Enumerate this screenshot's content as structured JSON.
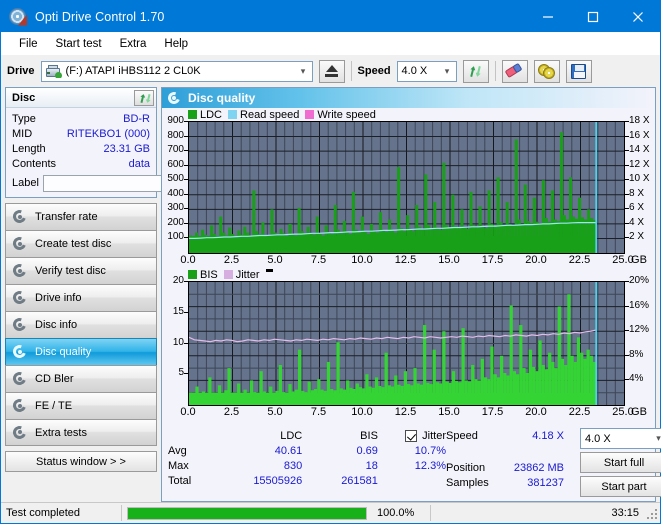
{
  "window": {
    "title": "Opti Drive Control 1.70",
    "app_icon": "disc-icon",
    "minimize": "—",
    "maximize": "□",
    "close": "✕"
  },
  "menu": {
    "items": [
      "File",
      "Start test",
      "Extra",
      "Help"
    ]
  },
  "toolbar": {
    "drive_label": "Drive",
    "drive_value": "(F:)  ATAPI iHBS112  2 CL0K",
    "eject_icon": "eject-icon",
    "speed_label": "Speed",
    "speed_value": "4.0 X",
    "refresh_icon": "refresh-icon",
    "eraser_icon": "eraser-icon",
    "discs_icon": "two-discs-icon",
    "save_icon": "floppy-save-icon"
  },
  "disc_panel": {
    "title": "Disc",
    "refresh_icon": "refresh-icon",
    "rows": [
      {
        "key": "Type",
        "value": "BD-R"
      },
      {
        "key": "MID",
        "value": "RITEKBO1 (000)"
      },
      {
        "key": "Length",
        "value": "23.31 GB"
      },
      {
        "key": "Contents",
        "value": "data"
      }
    ],
    "label_key": "Label",
    "label_value": "",
    "label_placeholder": "",
    "label_button_icon": "disc-icon"
  },
  "sidebar": {
    "items": [
      {
        "label": "Transfer rate",
        "selected": false
      },
      {
        "label": "Create test disc",
        "selected": false
      },
      {
        "label": "Verify test disc",
        "selected": false
      },
      {
        "label": "Drive info",
        "selected": false
      },
      {
        "label": "Disc info",
        "selected": false
      },
      {
        "label": "Disc quality",
        "selected": true
      },
      {
        "label": "CD Bler",
        "selected": false
      },
      {
        "label": "FE / TE",
        "selected": false
      },
      {
        "label": "Extra tests",
        "selected": false
      }
    ],
    "status_window_button": "Status window > >"
  },
  "card": {
    "title": "Disc quality",
    "icon": "disc-quality-icon"
  },
  "chart_data": [
    {
      "type": "bar",
      "title": "Disc quality - LDC",
      "legend": [
        {
          "label": "LDC",
          "color": "#18a018"
        },
        {
          "label": "Read speed",
          "color": "#7fd4f2"
        },
        {
          "label": "Write speed",
          "color": "#f06cd0"
        }
      ],
      "legend_position": "top-left",
      "xlabel": "GB",
      "x": [
        0.0,
        2.5,
        5.0,
        7.5,
        10.0,
        12.5,
        15.0,
        17.5,
        20.0,
        22.5,
        25.0
      ],
      "xlim": [
        0,
        25
      ],
      "ylabel": "LDC",
      "ylim": [
        0,
        900
      ],
      "yticks": [
        100,
        200,
        300,
        400,
        500,
        600,
        700,
        800,
        900
      ],
      "y2label": "Speed",
      "y2lim": [
        0,
        18
      ],
      "y2ticks": [
        "2 X",
        "4 X",
        "6 X",
        "8 X",
        "10 X",
        "12 X",
        "14 X",
        "16 X",
        "18 X"
      ],
      "grid": true,
      "plot_bg": "#66738c",
      "data_end_gb": 23.4,
      "cursor_line_color": "#49d8f4",
      "series": [
        {
          "name": "LDC",
          "color": "#18a018",
          "values": [
            120,
            95,
            140,
            110,
            160,
            125,
            105,
            190,
            130,
            115,
            250,
            140,
            120,
            175,
            130,
            110,
            155,
            125,
            180,
            140,
            120,
            430,
            150,
            130,
            210,
            125,
            115,
            300,
            140,
            125,
            165,
            135,
            115,
            200,
            130,
            120,
            310,
            150,
            130,
            180,
            140,
            125,
            250,
            135,
            120,
            190,
            145,
            130,
            330,
            160,
            135,
            220,
            150,
            130,
            420,
            160,
            140,
            250,
            145,
            130,
            200,
            150,
            140,
            280,
            160,
            145,
            230,
            155,
            140,
            590,
            170,
            150,
            260,
            160,
            150,
            330,
            180,
            160,
            540,
            190,
            165,
            350,
            175,
            160,
            620,
            190,
            170,
            400,
            185,
            170,
            300,
            180,
            165,
            420,
            190,
            175,
            320,
            185,
            170,
            430,
            200,
            180,
            520,
            210,
            190,
            350,
            200,
            190,
            780,
            230,
            200,
            470,
            220,
            205,
            380,
            215,
            200,
            500,
            240,
            215,
            430,
            230,
            220,
            830,
            260,
            230,
            520,
            250,
            235,
            380,
            245,
            230,
            300,
            240,
            225
          ]
        },
        {
          "name": "Read speed",
          "color": "#9fe3f7",
          "values": [
            2.0,
            2.0,
            2.05,
            2.1,
            2.1,
            2.15,
            2.2,
            2.2,
            2.25,
            2.3,
            2.3,
            2.35,
            2.4,
            2.4,
            2.45,
            2.5,
            2.5,
            2.55,
            2.6,
            2.6,
            2.65,
            2.7,
            2.7,
            2.75,
            2.8,
            2.8,
            2.85,
            2.9,
            2.9,
            2.95,
            3.0,
            3.0,
            3.05,
            3.1,
            3.1,
            3.15,
            3.2,
            3.2,
            3.25,
            3.3,
            3.3,
            3.35,
            3.4,
            3.4,
            3.45,
            3.5,
            3.5,
            3.55,
            3.6,
            3.6,
            3.65,
            3.7,
            3.7,
            3.75,
            3.8,
            3.8,
            3.85,
            3.9,
            3.9,
            3.95,
            4.0,
            4.0,
            4.05,
            4.1,
            4.1,
            4.15,
            4.18,
            4.18,
            4.18,
            4.18
          ]
        }
      ]
    },
    {
      "type": "bar",
      "title": "Disc quality - BIS",
      "legend": [
        {
          "label": "BIS",
          "color": "#18a018"
        },
        {
          "label": "Jitter",
          "color": "#d7aee0"
        }
      ],
      "legend_position": "top-left",
      "legend_marker": "black-rect-marker",
      "xlabel": "GB",
      "x": [
        0.0,
        2.5,
        5.0,
        7.5,
        10.0,
        12.5,
        15.0,
        17.5,
        20.0,
        22.5,
        25.0
      ],
      "xlim": [
        0,
        25
      ],
      "ylabel": "BIS",
      "ylim": [
        0,
        20
      ],
      "yticks": [
        5,
        10,
        15,
        20
      ],
      "y2label": "Jitter",
      "y2lim": [
        0,
        20
      ],
      "y2ticks": [
        "4%",
        "8%",
        "12%",
        "16%",
        "20%"
      ],
      "grid": true,
      "plot_bg": "#66738c",
      "data_end_gb": 23.4,
      "cursor_line_color": "#49d8f4",
      "series": [
        {
          "name": "BIS",
          "color": "#35d435",
          "values": [
            2.0,
            1.5,
            3.0,
            1.8,
            2.2,
            1.6,
            4.5,
            2.0,
            1.7,
            3.2,
            1.9,
            2.4,
            6.0,
            1.8,
            2.0,
            3.5,
            1.7,
            2.5,
            1.9,
            4.0,
            2.1,
            1.8,
            5.5,
            2.2,
            1.9,
            3.0,
            2.0,
            2.3,
            6.5,
            2.1,
            2.0,
            3.4,
            2.2,
            2.5,
            9.0,
            2.3,
            2.1,
            3.8,
            2.4,
            2.6,
            4.2,
            2.5,
            2.3,
            7.0,
            2.6,
            2.4,
            10.2,
            2.7,
            2.5,
            4.0,
            2.8,
            2.6,
            3.5,
            2.9,
            2.7,
            5.0,
            3.0,
            2.8,
            4.5,
            3.1,
            2.9,
            8.5,
            3.2,
            3.0,
            4.8,
            3.3,
            3.1,
            5.5,
            3.4,
            3.2,
            6.0,
            3.5,
            3.3,
            13.0,
            3.6,
            3.4,
            9.0,
            3.7,
            3.5,
            12.0,
            3.8,
            3.6,
            5.5,
            3.9,
            3.7,
            12.5,
            4.0,
            3.8,
            6.5,
            4.2,
            4.0,
            7.5,
            4.5,
            4.2,
            9.5,
            5.0,
            4.5,
            8.0,
            5.2,
            4.8,
            16.2,
            5.5,
            5.0,
            13.0,
            6.0,
            5.2,
            9.0,
            6.2,
            5.5,
            10.5,
            6.5,
            5.8,
            8.5,
            7.0,
            6.0,
            16.0,
            7.5,
            6.5,
            18.0,
            8.0,
            7.0,
            11.0,
            8.5,
            7.5,
            9.0,
            8.0,
            7.0
          ]
        },
        {
          "name": "Jitter",
          "color": "#e3bce9",
          "values": [
            11.0,
            10.6,
            10.5,
            10.4,
            10.3,
            10.5,
            10.4,
            10.6,
            10.5,
            10.3,
            10.4,
            10.6,
            10.5,
            10.4,
            10.6,
            10.5,
            10.7,
            10.6,
            10.5,
            10.4,
            10.6,
            10.5,
            10.7,
            10.6,
            10.5,
            10.7,
            10.6,
            10.8,
            10.7,
            10.6,
            10.8,
            10.7,
            10.9,
            10.8,
            10.7,
            10.9,
            10.8,
            11.0,
            10.9,
            10.8,
            11.0,
            10.9,
            11.1,
            11.0,
            10.9,
            11.1,
            11.0,
            10.9,
            11.0,
            11.1,
            11.0,
            11.2,
            11.1,
            11.0,
            11.2,
            11.1,
            11.3,
            11.2,
            11.1,
            11.3,
            11.2,
            11.4,
            11.3,
            11.2,
            11.4,
            11.3,
            11.5,
            11.4,
            11.6,
            11.5,
            11.7,
            11.6,
            11.8,
            11.7,
            11.9,
            12.0,
            12.2
          ]
        }
      ]
    }
  ],
  "stats": {
    "headers": {
      "blank": "",
      "ldc": "LDC",
      "bis": "BIS",
      "jitter": "Jitter"
    },
    "jitter_checked": true,
    "rows": [
      {
        "key": "Avg",
        "ldc": "40.61",
        "bis": "0.69",
        "jitter": "10.7%"
      },
      {
        "key": "Max",
        "ldc": "830",
        "bis": "18",
        "jitter": "12.3%"
      },
      {
        "key": "Total",
        "ldc": "15505926",
        "bis": "261581",
        "jitter": ""
      }
    ],
    "right": {
      "speed_key": "Speed",
      "speed_value": "4.18 X",
      "position_key": "Position",
      "position_value": "23862 MB",
      "samples_key": "Samples",
      "samples_value": "381237",
      "speed_select": "4.0 X",
      "start_full": "Start full",
      "start_part": "Start part"
    }
  },
  "statusbar": {
    "message": "Test completed",
    "progress_text": "100.0%",
    "progress_percent": 100,
    "elapsed": "33:15"
  }
}
